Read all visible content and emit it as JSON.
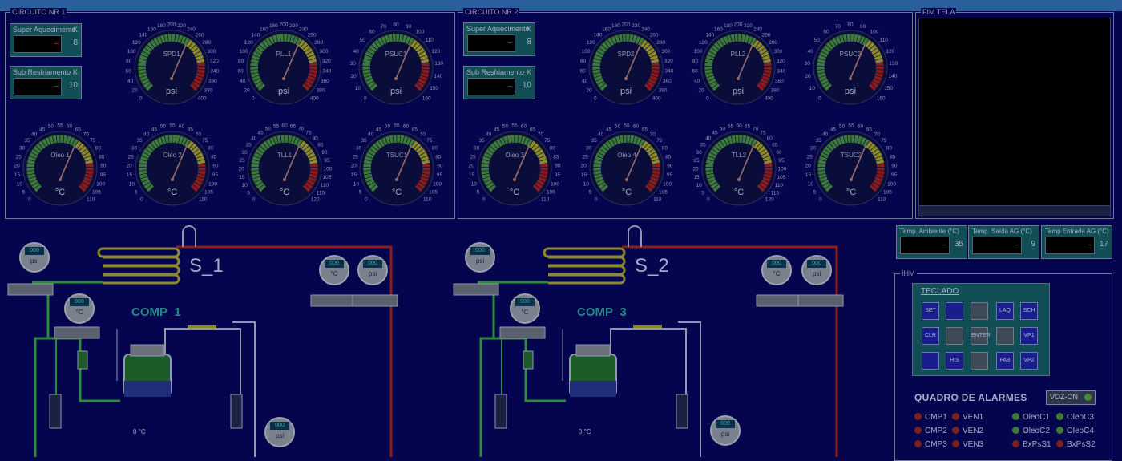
{
  "window": {
    "title": ""
  },
  "circuit1": {
    "title": "CIRCUITO NR 1",
    "super": {
      "label": "Super Aquecimento",
      "unit": "K",
      "value": "8"
    },
    "sub": {
      "label": "Sub   Resfriamento",
      "unit": "K",
      "value": "10"
    },
    "gauges": [
      {
        "name": "SPD1",
        "unit": "psi",
        "ticks": [
          "0",
          "20",
          "40",
          "60",
          "80",
          "100",
          "120",
          "140",
          "160",
          "180",
          "200",
          "220",
          "240",
          "260",
          "280",
          "300",
          "320",
          "340",
          "360",
          "380",
          "400"
        ],
        "needle": 0.62
      },
      {
        "name": "PLL1",
        "unit": "psi",
        "ticks": [
          "0",
          "20",
          "40",
          "60",
          "80",
          "100",
          "120",
          "140",
          "160",
          "180",
          "200",
          "220",
          "240",
          "260",
          "280",
          "300",
          "320",
          "340",
          "360",
          "380",
          "400"
        ],
        "needle": 0.62
      },
      {
        "name": "PSUC1",
        "unit": "psi",
        "ticks": [
          "0",
          "10",
          "20",
          "30",
          "40",
          "50",
          "60",
          "70",
          "80",
          "90",
          "100",
          "110",
          "120",
          "130",
          "140",
          "150",
          "160"
        ],
        "needle": 0.62
      },
      {
        "name": "Óleo 1",
        "unit": "°C",
        "ticks": [
          "0",
          "5",
          "10",
          "15",
          "20",
          "25",
          "30",
          "35",
          "40",
          "45",
          "50",
          "55",
          "60",
          "65",
          "70",
          "75",
          "80",
          "85",
          "90",
          "95",
          "100",
          "105",
          "110"
        ],
        "needle": 0.62
      },
      {
        "name": "Óleo 2",
        "unit": "°C",
        "ticks": [
          "0",
          "5",
          "10",
          "15",
          "20",
          "25",
          "30",
          "35",
          "40",
          "45",
          "50",
          "55",
          "60",
          "65",
          "70",
          "75",
          "80",
          "85",
          "90",
          "95",
          "100",
          "105",
          "110"
        ],
        "needle": 0.62
      },
      {
        "name": "TLL1",
        "unit": "°C",
        "ticks": [
          "0",
          "5",
          "10",
          "15",
          "20",
          "25",
          "30",
          "35",
          "40",
          "45",
          "50",
          "55",
          "60",
          "65",
          "70",
          "75",
          "80",
          "85",
          "90",
          "95",
          "100",
          "105",
          "110",
          "115",
          "120"
        ],
        "needle": 0.62
      },
      {
        "name": "TSUC1",
        "unit": "°C",
        "ticks": [
          "0",
          "5",
          "10",
          "15",
          "20",
          "25",
          "30",
          "35",
          "40",
          "45",
          "50",
          "55",
          "60",
          "65",
          "70",
          "75",
          "80",
          "85",
          "90",
          "95",
          "100",
          "105",
          "110"
        ],
        "needle": 0.62
      }
    ]
  },
  "circuit2": {
    "title": "CIRCUITO NR 2",
    "super": {
      "label": "Super Aquecimento",
      "unit": "K",
      "value": "8"
    },
    "sub": {
      "label": "Sub   Resfriamento",
      "unit": "K",
      "value": "10"
    },
    "gauges": [
      {
        "name": "SPD2",
        "unit": "psi",
        "ticks": [
          "0",
          "20",
          "40",
          "60",
          "80",
          "100",
          "120",
          "140",
          "160",
          "180",
          "200",
          "220",
          "240",
          "260",
          "280",
          "300",
          "320",
          "340",
          "360",
          "380",
          "400"
        ],
        "needle": 0.62
      },
      {
        "name": "PLL2",
        "unit": "psi",
        "ticks": [
          "0",
          "20",
          "40",
          "60",
          "80",
          "100",
          "120",
          "140",
          "160",
          "180",
          "200",
          "220",
          "240",
          "260",
          "280",
          "300",
          "320",
          "340",
          "360",
          "380",
          "400"
        ],
        "needle": 0.62
      },
      {
        "name": "PSUC2",
        "unit": "psi",
        "ticks": [
          "0",
          "10",
          "20",
          "30",
          "40",
          "50",
          "60",
          "70",
          "80",
          "90",
          "100",
          "110",
          "120",
          "130",
          "140",
          "150",
          "160"
        ],
        "needle": 0.62
      },
      {
        "name": "Óleo 3",
        "unit": "°C",
        "ticks": [
          "0",
          "5",
          "10",
          "15",
          "20",
          "25",
          "30",
          "35",
          "40",
          "45",
          "50",
          "55",
          "60",
          "65",
          "70",
          "75",
          "80",
          "85",
          "90",
          "95",
          "100",
          "105",
          "110"
        ],
        "needle": 0.62
      },
      {
        "name": "Óleo 4",
        "unit": "°C",
        "ticks": [
          "0",
          "5",
          "10",
          "15",
          "20",
          "25",
          "30",
          "35",
          "40",
          "45",
          "50",
          "55",
          "60",
          "65",
          "70",
          "75",
          "80",
          "85",
          "90",
          "95",
          "100",
          "105",
          "110"
        ],
        "needle": 0.62
      },
      {
        "name": "TLL2",
        "unit": "°C",
        "ticks": [
          "0",
          "5",
          "10",
          "15",
          "20",
          "25",
          "30",
          "35",
          "40",
          "45",
          "50",
          "55",
          "60",
          "65",
          "70",
          "75",
          "80",
          "85",
          "90",
          "95",
          "100",
          "105",
          "110",
          "115",
          "120"
        ],
        "needle": 0.62
      },
      {
        "name": "TSUC2",
        "unit": "°C",
        "ticks": [
          "0",
          "5",
          "10",
          "15",
          "20",
          "25",
          "30",
          "35",
          "40",
          "45",
          "50",
          "55",
          "60",
          "65",
          "70",
          "75",
          "80",
          "85",
          "90",
          "95",
          "100",
          "105",
          "110"
        ],
        "needle": 0.62
      }
    ]
  },
  "screen": {
    "title": "FIM TELA"
  },
  "temps": [
    {
      "label": "Temp.  Ambiente  (°C)",
      "value": "35"
    },
    {
      "label": "Temp.  Saída  AG (°C)",
      "value": "9"
    },
    {
      "label": "Temp Entrada AG (°C)",
      "value": "17"
    }
  ],
  "ihm": {
    "title": "IHM",
    "keypad_title": "TECLADO",
    "keys": [
      "SET",
      "",
      "",
      "LAQ",
      "SCH",
      "CLR",
      "",
      "ENTER",
      "",
      "VP1",
      "",
      "HIS",
      "",
      "FAB",
      "VP2"
    ]
  },
  "alarms": {
    "title": "QUADRO DE ALARMES",
    "voz": "VOZ-ON",
    "items": [
      {
        "label": "CMP1",
        "color": "r"
      },
      {
        "label": "VEN1",
        "color": "r"
      },
      {
        "label": "OleoC1",
        "color": "g"
      },
      {
        "label": "OleoC3",
        "color": "g"
      },
      {
        "label": "CMP2",
        "color": "r"
      },
      {
        "label": "VEN2",
        "color": "r"
      },
      {
        "label": "OleoC2",
        "color": "g"
      },
      {
        "label": "OleoC4",
        "color": "g"
      },
      {
        "label": "CMP3",
        "color": "r"
      },
      {
        "label": "VEN3",
        "color": "r"
      },
      {
        "label": "BxPsS1",
        "color": "r"
      },
      {
        "label": "BxPsS2",
        "color": "r"
      }
    ]
  },
  "systems": [
    {
      "name": "S_1",
      "compressor": "COMP_1",
      "comp_temp": "0    °C"
    },
    {
      "name": "S_2",
      "compressor": "COMP_3",
      "comp_temp": "0    °C"
    }
  ],
  "small_gauges": {
    "psi": "psi",
    "c": "°C",
    "reading": "000"
  }
}
